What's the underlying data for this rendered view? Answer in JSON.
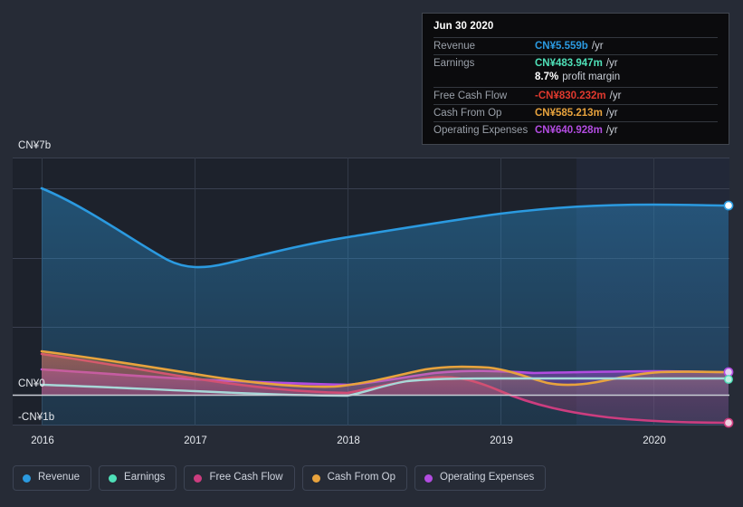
{
  "colors": {
    "background": "#262b36",
    "plot_bg": "#1d222c",
    "forecast_bg": "#222838",
    "grid": "#3a4050",
    "zero_line": "#c8ccd4",
    "revenue": "#2b9ae0",
    "earnings": "#4fe0b8",
    "free_cash_flow": "#cc3d7f",
    "cash_from_op": "#e8a33d",
    "operating_expenses": "#b24ce0",
    "tooltip_bg": "#0b0b0d",
    "tooltip_border": "#41464f",
    "tooltip_key": "#9aa0a9",
    "negative": "#e0392e"
  },
  "tooltip": {
    "title": "Jun 30 2020",
    "rows": [
      {
        "key": "Revenue",
        "value": "CN¥5.559b",
        "unit": "/yr",
        "color": "#2b9ae0"
      },
      {
        "key": "Earnings",
        "value": "CN¥483.947m",
        "unit": "/yr",
        "color": "#4fe0b8"
      },
      {
        "key": "",
        "value": "8.7%",
        "unit": "profit margin",
        "color": "#ffffff",
        "sub": true
      },
      {
        "key": "Free Cash Flow",
        "value": "-CN¥830.232m",
        "unit": "/yr",
        "color": "#e0392e"
      },
      {
        "key": "Cash From Op",
        "value": "CN¥585.213m",
        "unit": "/yr",
        "color": "#e8a33d"
      },
      {
        "key": "Operating Expenses",
        "value": "CN¥640.928m",
        "unit": "/yr",
        "color": "#b24ce0"
      }
    ]
  },
  "legend": {
    "items": [
      {
        "label": "Revenue",
        "color": "#2b9ae0"
      },
      {
        "label": "Earnings",
        "color": "#4fe0b8"
      },
      {
        "label": "Free Cash Flow",
        "color": "#cc3d7f"
      },
      {
        "label": "Cash From Op",
        "color": "#e8a33d"
      },
      {
        "label": "Operating Expenses",
        "color": "#b24ce0"
      }
    ]
  },
  "axes": {
    "y_labels": [
      "CN¥7b",
      "CN¥0",
      "-CN¥1b"
    ],
    "x_labels": [
      "2016",
      "2017",
      "2018",
      "2019",
      "2020"
    ]
  },
  "chart_data": {
    "type": "area",
    "title": "",
    "subtitle": "",
    "xlabel": "",
    "ylabel": "",
    "currency": "CN¥",
    "grid": true,
    "legend_position": "bottom",
    "ylim": [
      -1.5,
      8
    ],
    "y_ticks": [
      7,
      0,
      -1
    ],
    "y_tick_labels": [
      "CN¥7b",
      "CN¥0",
      "-CN¥1b"
    ],
    "x": [
      "2016",
      "2016.5",
      "2017",
      "2017.5",
      "2018",
      "2018.5",
      "2019",
      "2019.5",
      "2020",
      "2020.5"
    ],
    "x_ticks": [
      "2016",
      "2017",
      "2018",
      "2019",
      "2020"
    ],
    "xlim": [
      "2016",
      "2020.5"
    ],
    "forecast_start": "2019.25",
    "units": "billions CN¥",
    "series": [
      {
        "name": "Revenue",
        "color": "#2b9ae0",
        "values": [
          6.55,
          5.75,
          5.07,
          5.02,
          5.12,
          5.25,
          5.38,
          5.5,
          5.56,
          5.559
        ]
      },
      {
        "name": "Earnings",
        "color": "#4fe0b8",
        "values": [
          0.02,
          0.0,
          -0.03,
          -0.07,
          -0.05,
          0.2,
          0.35,
          0.42,
          0.46,
          0.484
        ]
      },
      {
        "name": "Free Cash Flow",
        "color": "#cc3d7f",
        "values": [
          1.05,
          0.8,
          0.5,
          0.18,
          -0.02,
          0.25,
          0.32,
          -0.45,
          -0.74,
          -0.83
        ]
      },
      {
        "name": "Cash From Op",
        "color": "#e8a33d",
        "values": [
          1.15,
          0.92,
          0.62,
          0.3,
          0.1,
          0.55,
          0.72,
          0.3,
          0.5,
          0.585
        ]
      },
      {
        "name": "Operating Expenses",
        "color": "#b24ce0",
        "values": [
          0.6,
          0.5,
          0.42,
          0.35,
          0.3,
          0.42,
          0.52,
          0.58,
          0.62,
          0.641
        ]
      }
    ],
    "end_points": [
      {
        "name": "Revenue",
        "value": 5.559
      },
      {
        "name": "Operating Expenses",
        "value": 0.641
      },
      {
        "name": "Earnings",
        "value": 0.484
      },
      {
        "name": "Free Cash Flow",
        "value": -0.83
      }
    ]
  }
}
